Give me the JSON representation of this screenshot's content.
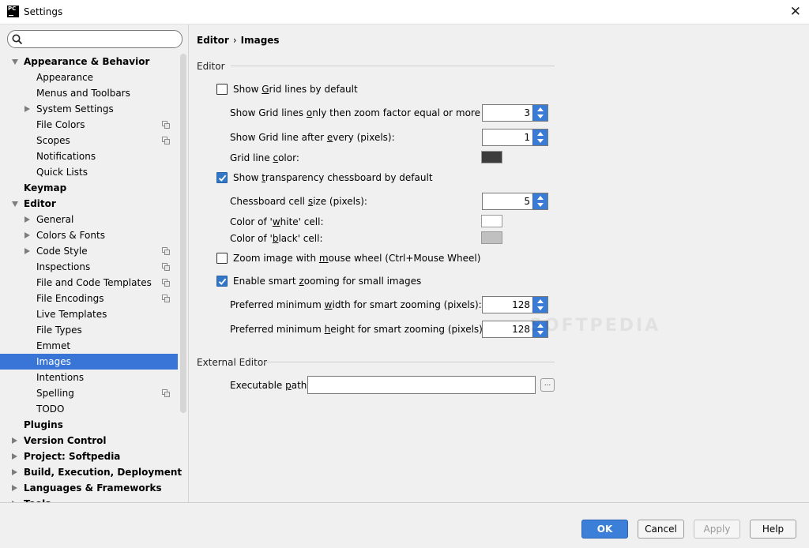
{
  "window": {
    "title": "Settings",
    "app_badge": "PC"
  },
  "search": {
    "placeholder": "",
    "value": ""
  },
  "tree": [
    {
      "label": "Appearance & Behavior",
      "bold": true,
      "arrow": "down",
      "indent": 0
    },
    {
      "label": "Appearance",
      "indent": 2
    },
    {
      "label": "Menus and Toolbars",
      "indent": 2
    },
    {
      "label": "System Settings",
      "arrow": "right",
      "indent": 1
    },
    {
      "label": "File Colors",
      "indent": 2,
      "project_icon": true
    },
    {
      "label": "Scopes",
      "indent": 2,
      "project_icon": true
    },
    {
      "label": "Notifications",
      "indent": 2
    },
    {
      "label": "Quick Lists",
      "indent": 2
    },
    {
      "label": "Keymap",
      "bold": true,
      "indent": 0
    },
    {
      "label": "Editor",
      "bold": true,
      "arrow": "down",
      "indent": 0
    },
    {
      "label": "General",
      "arrow": "right",
      "indent": 1
    },
    {
      "label": "Colors & Fonts",
      "arrow": "right",
      "indent": 1
    },
    {
      "label": "Code Style",
      "arrow": "right",
      "indent": 1,
      "project_icon": true
    },
    {
      "label": "Inspections",
      "indent": 2,
      "project_icon": true
    },
    {
      "label": "File and Code Templates",
      "indent": 2,
      "project_icon": true
    },
    {
      "label": "File Encodings",
      "indent": 2,
      "project_icon": true
    },
    {
      "label": "Live Templates",
      "indent": 2
    },
    {
      "label": "File Types",
      "indent": 2
    },
    {
      "label": "Emmet",
      "indent": 2
    },
    {
      "label": "Images",
      "indent": 2,
      "selected": true
    },
    {
      "label": "Intentions",
      "indent": 2
    },
    {
      "label": "Spelling",
      "indent": 2,
      "project_icon": true
    },
    {
      "label": "TODO",
      "indent": 2
    },
    {
      "label": "Plugins",
      "bold": true,
      "indent": 0
    },
    {
      "label": "Version Control",
      "bold": true,
      "arrow": "right",
      "indent": 0
    },
    {
      "label": "Project: Softpedia",
      "bold": true,
      "arrow": "right",
      "indent": 0
    },
    {
      "label": "Build, Execution, Deployment",
      "bold": true,
      "arrow": "right",
      "indent": 0
    },
    {
      "label": "Languages & Frameworks",
      "bold": true,
      "arrow": "right",
      "indent": 0
    },
    {
      "label": "Tools",
      "bold": true,
      "arrow": "right",
      "indent": 0
    }
  ],
  "breadcrumb": {
    "parent": "Editor",
    "separator": "›",
    "current": "Images"
  },
  "editor_section": {
    "title": "Editor",
    "show_grid": {
      "before": "Show ",
      "mnemonic": "G",
      "after": "rid lines by default",
      "checked": false
    },
    "grid_zoom": {
      "before": "Show Grid lines ",
      "mnemonic": "o",
      "after": "nly then zoom factor equal or more than:",
      "value": "3"
    },
    "grid_every": {
      "before": "Show Grid line after ",
      "mnemonic": "e",
      "after": "very (pixels):",
      "value": "1"
    },
    "grid_color": {
      "before": "Grid line ",
      "mnemonic": "c",
      "after": "olor:",
      "color": "#3c3c3c"
    },
    "show_chessboard": {
      "before": "Show ",
      "mnemonic": "t",
      "after": "ransparency chessboard by default",
      "checked": true
    },
    "cell_size": {
      "before": "Chessboard cell ",
      "mnemonic": "s",
      "after": "ize (pixels):",
      "value": "5"
    },
    "white_cell": {
      "before": "Color of '",
      "mnemonic": "w",
      "after": "hite' cell:",
      "color": "#ffffff"
    },
    "black_cell": {
      "before": "Color of '",
      "mnemonic": "b",
      "after": "lack' cell:",
      "color": "#c0c0c0"
    },
    "zoom_wheel": {
      "before": "Zoom image with ",
      "mnemonic": "m",
      "after": "ouse wheel (Ctrl+Mouse Wheel)",
      "checked": false
    },
    "smart_zoom": {
      "before": "Enable smart ",
      "mnemonic": "z",
      "after": "ooming for small images",
      "checked": true
    },
    "min_width": {
      "before": "Preferred minimum ",
      "mnemonic": "w",
      "after": "idth for smart zooming (pixels):",
      "value": "128"
    },
    "min_height": {
      "before": "Preferred minimum ",
      "mnemonic": "h",
      "after": "eight for smart zooming (pixels):",
      "value": "128"
    }
  },
  "external_section": {
    "title": "External Editor",
    "exec_path": {
      "before": "Executable ",
      "mnemonic": "p",
      "after": "ath:",
      "value": "",
      "browse_label": "..."
    }
  },
  "buttons": {
    "ok": "OK",
    "cancel": "Cancel",
    "apply": "Apply",
    "help": "Help"
  },
  "watermark": "SOFTPEDIA",
  "colors": {
    "accent": "#3875d7",
    "primary_button": "#3c7fd8"
  }
}
